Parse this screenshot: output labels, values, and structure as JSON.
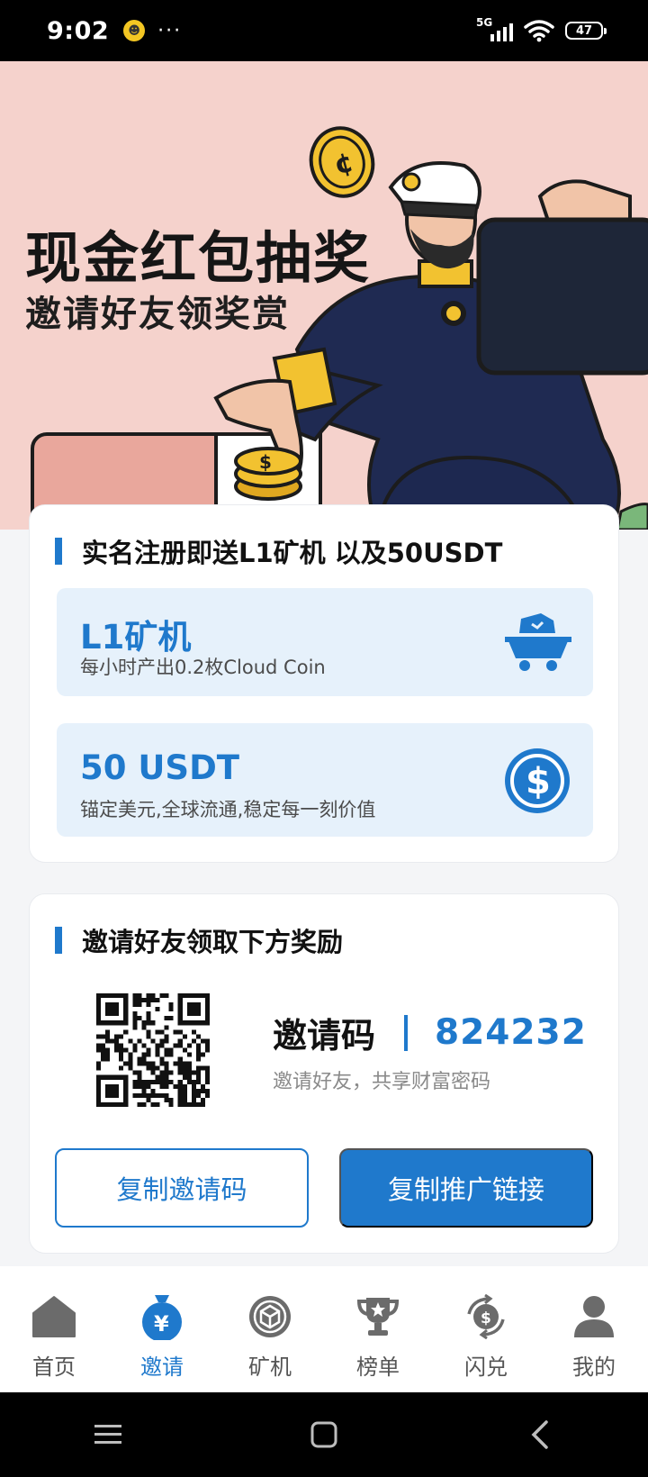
{
  "status_bar": {
    "time": "9:02",
    "network": "5G",
    "battery": "47",
    "more_glyph": "···"
  },
  "banner": {
    "title": "现金红包抽奖",
    "subtitle": "邀请好友领奖赏"
  },
  "register_section": {
    "title": "实名注册即送L1矿机 以及50USDT",
    "rewards": [
      {
        "title": "L1矿机",
        "desc": "每小时产出0.2枚Cloud Coin",
        "icon": "mining-cart-icon"
      },
      {
        "title": "50 USDT",
        "desc": "锚定美元,全球流通,稳定每一刻价值",
        "icon": "dollar-coin-icon"
      }
    ]
  },
  "invite_section": {
    "title": "邀请好友领取下方奖励",
    "code_label": "邀请码",
    "code_value": "824232",
    "hint": "邀请好友，共享财富密码",
    "copy_code_button": "复制邀请码",
    "copy_link_button": "复制推广链接"
  },
  "tabs": [
    {
      "label": "首页",
      "icon": "home-icon",
      "active": false
    },
    {
      "label": "邀请",
      "icon": "money-bag-icon",
      "active": true
    },
    {
      "label": "矿机",
      "icon": "miner-cube-icon",
      "active": false
    },
    {
      "label": "榜单",
      "icon": "trophy-icon",
      "active": false
    },
    {
      "label": "闪兑",
      "icon": "exchange-coin-icon",
      "active": false
    },
    {
      "label": "我的",
      "icon": "person-icon",
      "active": false
    }
  ],
  "colors": {
    "accent": "#1f79cc",
    "banner_bg": "#f5d2cc",
    "reward_bg": "#e6f1fb",
    "page_bg": "#f4f5f7"
  }
}
